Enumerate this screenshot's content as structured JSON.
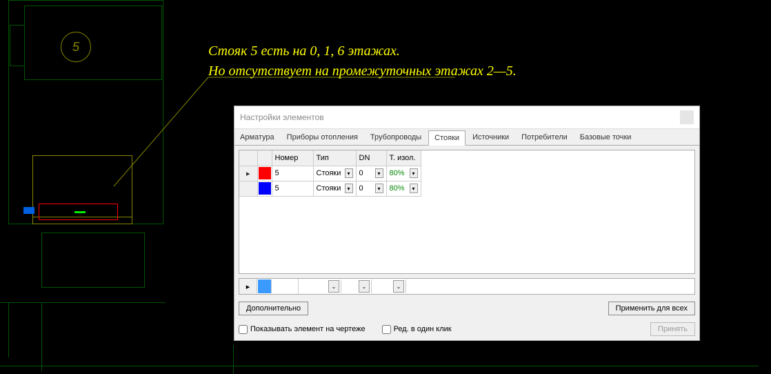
{
  "cad": {
    "circle_label": "5",
    "annotation_line1": "Стояк 5 есть на 0, 1, 6 этажах.",
    "annotation_line2": "Но отсутствует на промежуточных этажах 2—5."
  },
  "dialog": {
    "title": "Настройки элементов",
    "tabs": [
      {
        "label": "Арматура"
      },
      {
        "label": "Приборы отопления"
      },
      {
        "label": "Трубопроводы"
      },
      {
        "label": "Стояки",
        "active": true
      },
      {
        "label": "Источники"
      },
      {
        "label": "Потребители"
      },
      {
        "label": "Базовые точки"
      }
    ],
    "columns": {
      "number": "Номер",
      "type": "Тип",
      "dn": "DN",
      "t_izol": "Т. изол."
    },
    "rows": [
      {
        "color": "#ff0000",
        "number": "5",
        "type": "Стояки",
        "dn": "0",
        "t_izol": "80%"
      },
      {
        "color": "#0000ff",
        "number": "5",
        "type": "Стояки",
        "dn": "0",
        "t_izol": "80%"
      }
    ],
    "buttons": {
      "more": "Дополнительно",
      "apply_all": "Применить для всех",
      "accept": "Принять"
    },
    "checkboxes": {
      "show_on_drawing": "Показывать элемент на чертеже",
      "edit_one_click": "Ред. в один клик"
    }
  }
}
